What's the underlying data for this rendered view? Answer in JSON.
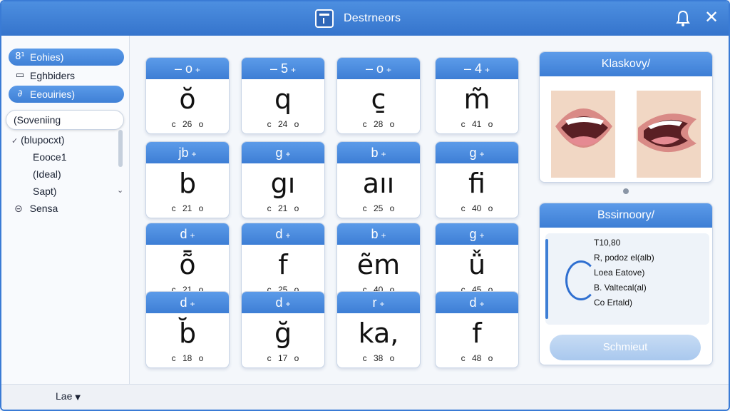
{
  "window": {
    "title": "Destrneors"
  },
  "sidebar": {
    "items": [
      {
        "label": "Eohies)",
        "icon": "shapes-icon",
        "glyph": "8¹"
      },
      {
        "label": "Eghbiders",
        "icon": "folder-icon",
        "glyph": "▭"
      },
      {
        "label": "Eeouiries)",
        "icon": "link-icon",
        "glyph": "∂"
      }
    ],
    "search_value": "(Soveniing",
    "list": [
      {
        "label": "(blupocxt)",
        "icon": "check-icon",
        "glyph": "✓"
      },
      {
        "label": "Eooce1",
        "icon": "",
        "glyph": ""
      },
      {
        "label": "(Ideal)",
        "icon": "",
        "glyph": ""
      },
      {
        "label": "Sapt)",
        "icon": "",
        "glyph": ""
      },
      {
        "label": "Sensa",
        "icon": "circle-icon",
        "glyph": "⊝"
      }
    ]
  },
  "grid": {
    "cards": [
      {
        "header": "– o",
        "symbol": "ŏ",
        "foot": "c 26 o"
      },
      {
        "header": "– 5",
        "symbol": "q",
        "foot": "c 24 o"
      },
      {
        "header": "– o",
        "symbol": "c̱",
        "foot": "c 28 o"
      },
      {
        "header": "– 4",
        "symbol": "m̃",
        "foot": "c 41 o"
      },
      {
        "header": "jb",
        "symbol": "b",
        "foot": "c 21 o"
      },
      {
        "header": "g",
        "symbol": "gı",
        "foot": "c 21 o"
      },
      {
        "header": "b",
        "symbol": "aıı",
        "foot": "c 25 o"
      },
      {
        "header": "g",
        "symbol": "fi",
        "foot": "c 40 o"
      },
      {
        "header": "d",
        "symbol": "ȭ",
        "foot": "c 21 o"
      },
      {
        "header": "d",
        "symbol": "f",
        "foot": "c 25 o"
      },
      {
        "header": "b",
        "symbol": "ẽm",
        "foot": "c 40 o"
      },
      {
        "header": "g",
        "symbol": "ǚ",
        "foot": "c 45 o"
      },
      {
        "header": "d",
        "symbol": "b̆",
        "foot": "c 18 o"
      },
      {
        "header": "d",
        "symbol": "ğ",
        "foot": "c 17 o"
      },
      {
        "header": "r",
        "symbol": "ka,",
        "foot": "c 38 o"
      },
      {
        "header": "d",
        "symbol": "f",
        "foot": "c 48 o"
      }
    ],
    "plus_glyph": "+"
  },
  "panel_top": {
    "title": "Klaskovy/"
  },
  "panel_bottom": {
    "title": "Bssirnoory/",
    "lines": [
      "T10,80",
      "R, podoz el(alb)",
      "Loea Eatove)",
      "B. Valtecal(al)",
      "Co Ertald)"
    ],
    "submit_label": "Schmieut"
  },
  "bottombar": {
    "lang_label": "Lae"
  },
  "colors": {
    "accent": "#3d7ed5",
    "title_bar": "#3574cc"
  }
}
